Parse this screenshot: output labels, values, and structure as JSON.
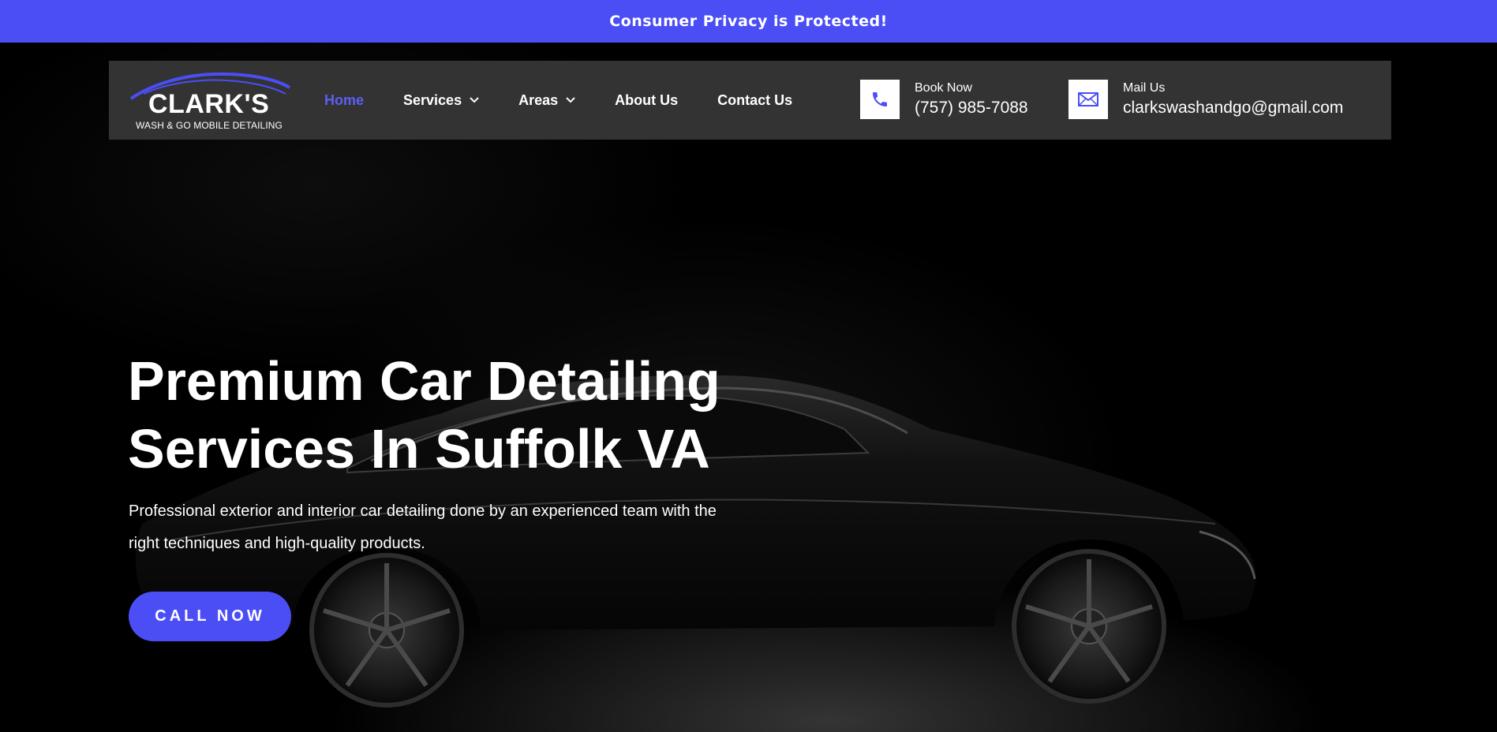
{
  "topbar": {
    "message": "Consumer Privacy is Protected!"
  },
  "logo": {
    "brand": "CLARK'S",
    "tagline": "WASH & GO MOBILE DETAILING"
  },
  "nav": {
    "items": [
      {
        "label": "Home",
        "active": true
      },
      {
        "label": "Services",
        "dropdown": true
      },
      {
        "label": "Areas",
        "dropdown": true
      },
      {
        "label": "About Us"
      },
      {
        "label": "Contact Us"
      }
    ]
  },
  "contact": {
    "phone": {
      "label": "Book Now",
      "value": "(757) 985-7088",
      "icon": "phone-icon"
    },
    "mail": {
      "label": "Mail Us",
      "value": "clarkswashandgo@gmail.com",
      "icon": "mail-icon"
    }
  },
  "hero": {
    "headline_line1": "Premium Car Detailing",
    "headline_line2": "Services In Suffolk VA",
    "subtext_line1": "Professional exterior and interior car detailing done by an experienced team with the",
    "subtext_line2": "right techniques and high-quality products.",
    "cta_label": "CALL NOW"
  },
  "colors": {
    "accent": "#4b4ef5",
    "header_bg": "#333333",
    "page_bg": "#000000",
    "active_link": "#5b5ff7"
  }
}
